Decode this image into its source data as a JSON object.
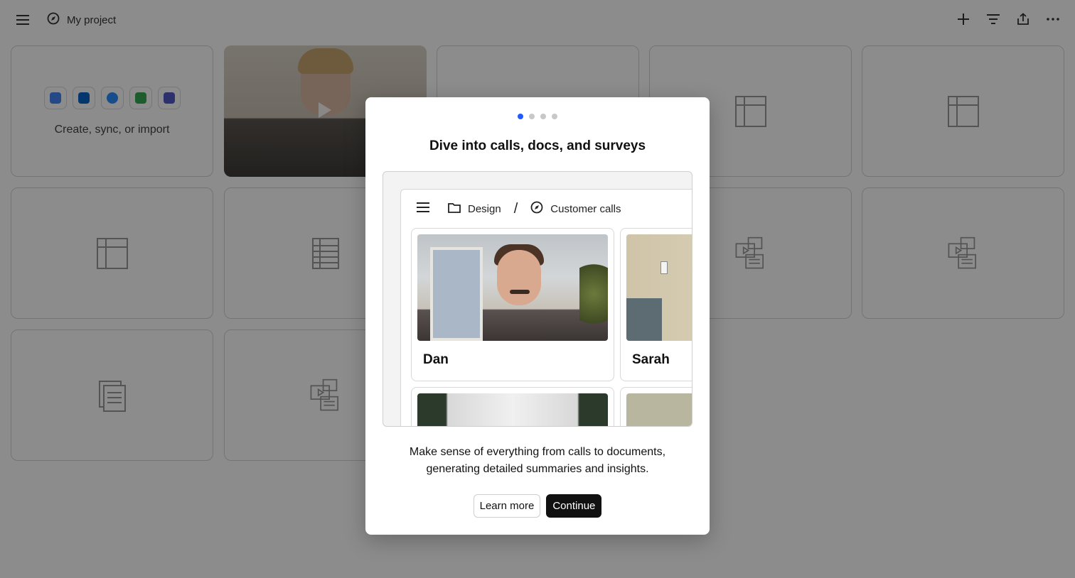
{
  "header": {
    "project_title": "My project",
    "menu_icon": "hamburger-menu-icon",
    "project_icon": "compass-icon",
    "actions": [
      "plus-icon",
      "filter-icon",
      "share-icon",
      "more-icon"
    ]
  },
  "grid": {
    "import_card": {
      "label": "Create, sync, or import",
      "apps": [
        {
          "name": "google-calendar-icon",
          "color": "#4285f4"
        },
        {
          "name": "outlook-icon",
          "color": "#0a64c8"
        },
        {
          "name": "zoom-icon",
          "color": "#2d8cff"
        },
        {
          "name": "google-meet-icon",
          "color": "#34a853"
        },
        {
          "name": "teams-icon",
          "color": "#5059c9"
        }
      ]
    }
  },
  "modal": {
    "step_count": 4,
    "active_step": 1,
    "title": "Dive into calls, docs, and surveys",
    "preview": {
      "breadcrumb_folder": "Design",
      "breadcrumb_separator": "/",
      "breadcrumb_page": "Customer calls",
      "people": [
        "Dan",
        "Sarah"
      ]
    },
    "description": "Make sense of everything from calls to documents, generating detailed summaries and insights.",
    "learn_more_label": "Learn more",
    "continue_label": "Continue",
    "accent_color": "#1f5cff"
  }
}
